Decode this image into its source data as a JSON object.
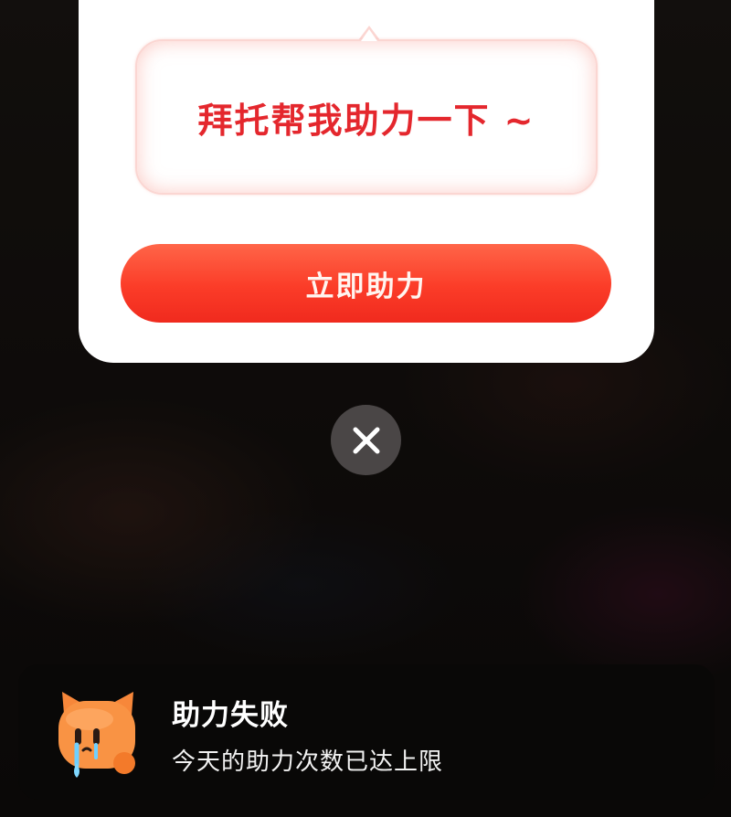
{
  "modal": {
    "bubble_text": "拜托帮我助力一下 ~",
    "help_button_label": "立即助力",
    "close_icon": "close-icon"
  },
  "toast": {
    "icon": "crying-cat-mascot-icon",
    "title": "助力失败",
    "message": "今天的助力次数已达上限"
  },
  "colors": {
    "accent_red": "#e4272d",
    "button_red": "#fb3c28",
    "toast_background": "#090807"
  }
}
